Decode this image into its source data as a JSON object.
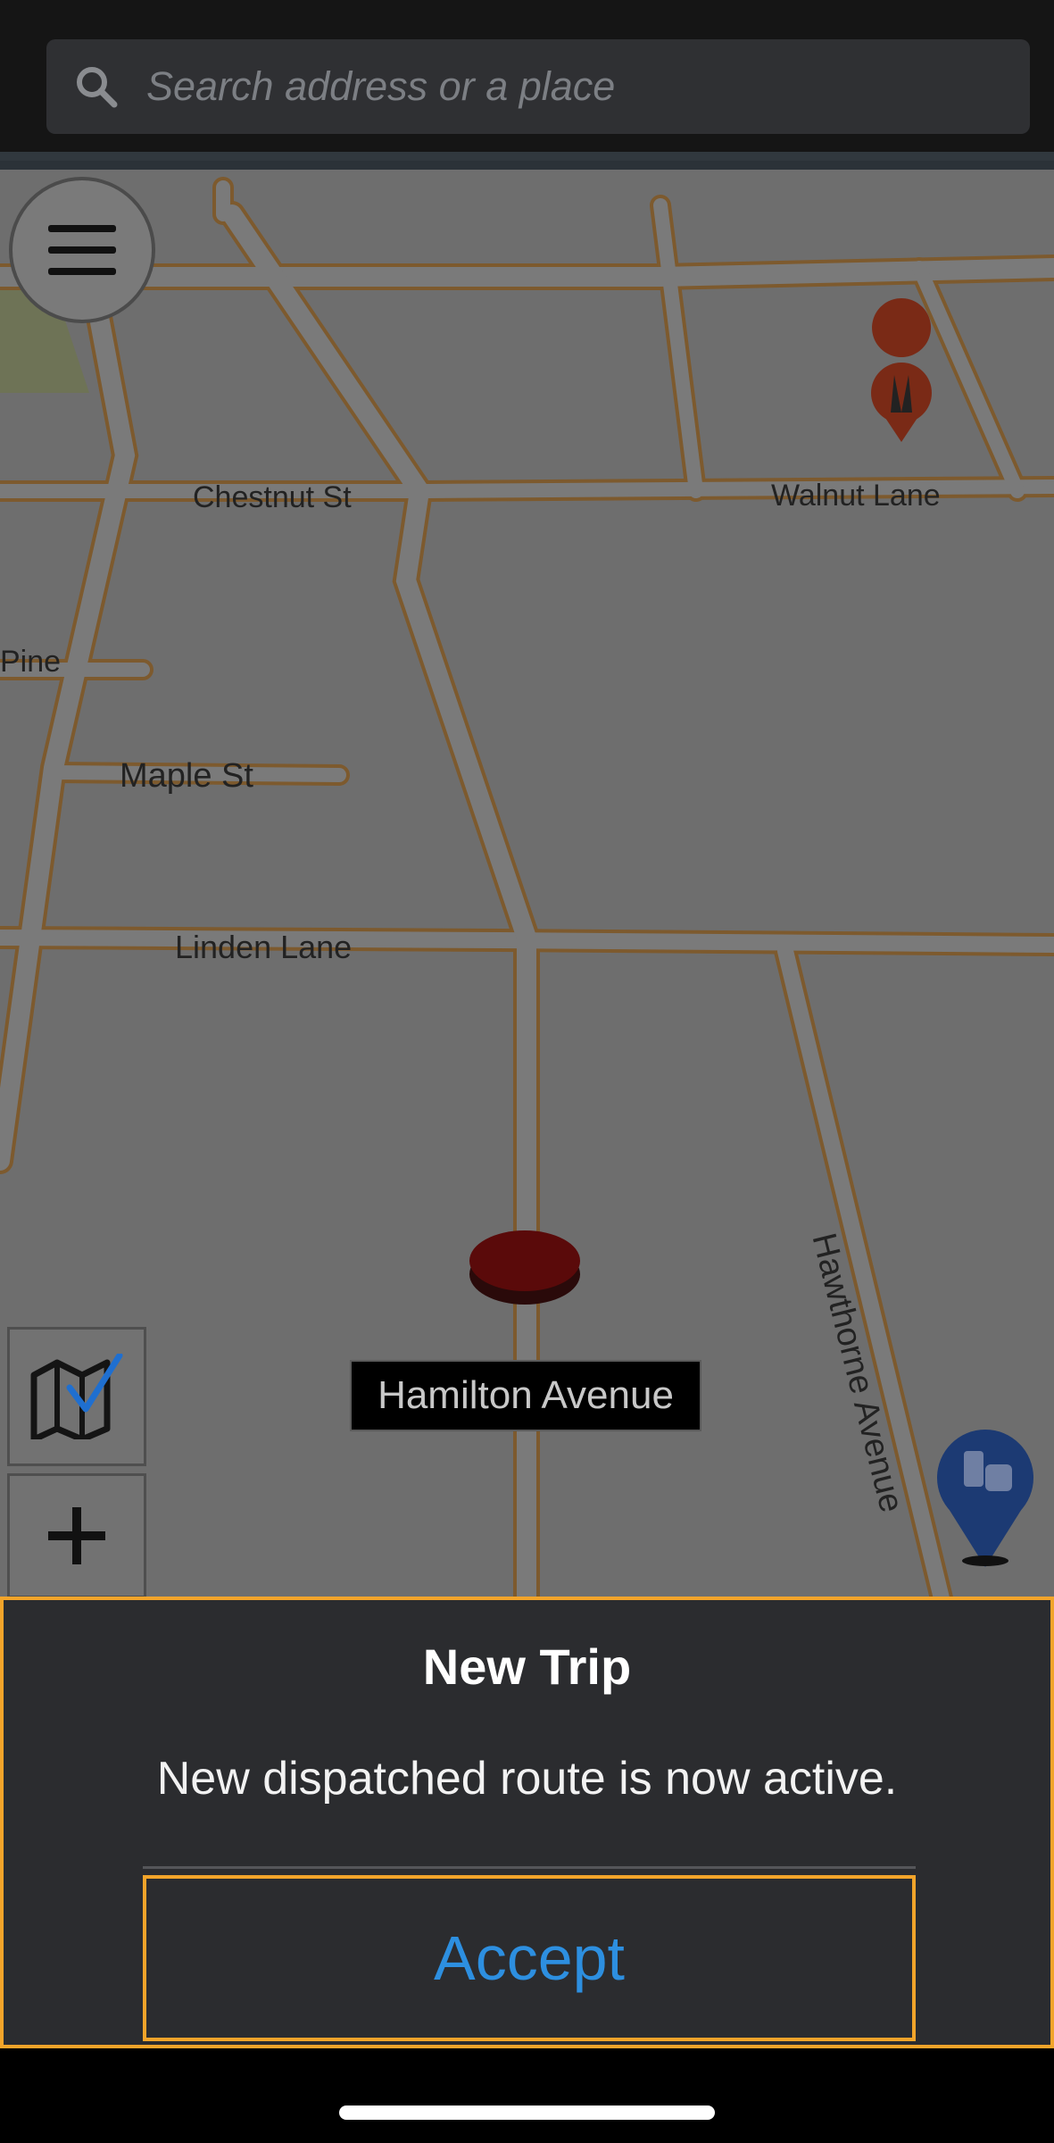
{
  "search": {
    "placeholder": "Search address or a place"
  },
  "map": {
    "streets": {
      "chestnut": "Chestnut St",
      "walnut": "Walnut Lane",
      "pine": "Pine",
      "maple": "Maple St",
      "linden": "Linden Lane",
      "hawthorne": "Hawthorne Avenue"
    },
    "current_street": "Hamilton Avenue"
  },
  "dialog": {
    "title": "New Trip",
    "message": "New dispatched route is now active.",
    "accept_label": "Accept"
  },
  "colors": {
    "accent_border": "#f2a42a",
    "accept_text": "#2d8fe0",
    "dialog_bg": "#2b2c2f"
  },
  "icons": [
    "search-icon",
    "menu-icon",
    "map-check-icon",
    "plus-icon",
    "place-of-worship-pin-icon",
    "ev-charging-pin-icon",
    "vehicle-position-icon"
  ]
}
